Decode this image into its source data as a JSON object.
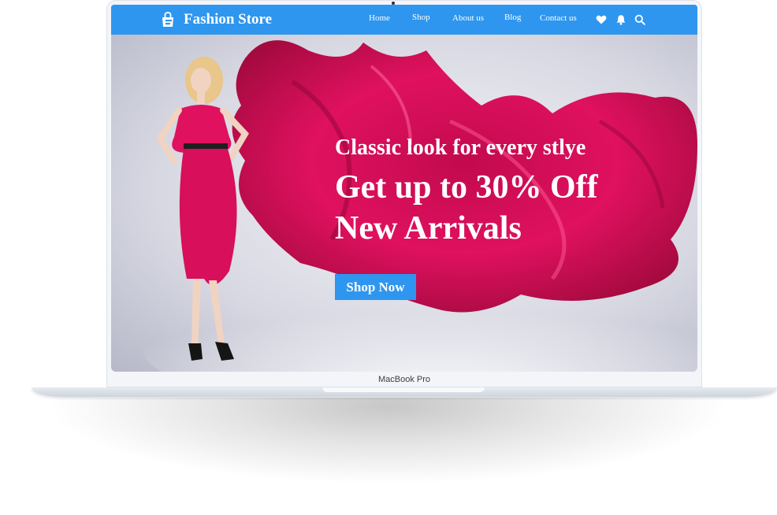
{
  "brand": {
    "name": "Fashion Store",
    "icon": "shopping-bag-icon"
  },
  "nav": {
    "links": [
      "Home",
      "Shop",
      "About us",
      "Blog",
      "Contact us"
    ],
    "icons": [
      "heart-icon",
      "bell-icon",
      "search-icon"
    ]
  },
  "hero": {
    "tagline": "Classic look for every stlye",
    "headline_line1": "Get up to 30% Off",
    "headline_line2": "New Arrivals",
    "cta_label": "Shop Now"
  },
  "device": {
    "label": "MacBook Pro"
  },
  "colors": {
    "accent": "#2e96ef",
    "fabric": "#e0115f",
    "background": "#d7d8e2",
    "text_light": "#ffffff"
  }
}
